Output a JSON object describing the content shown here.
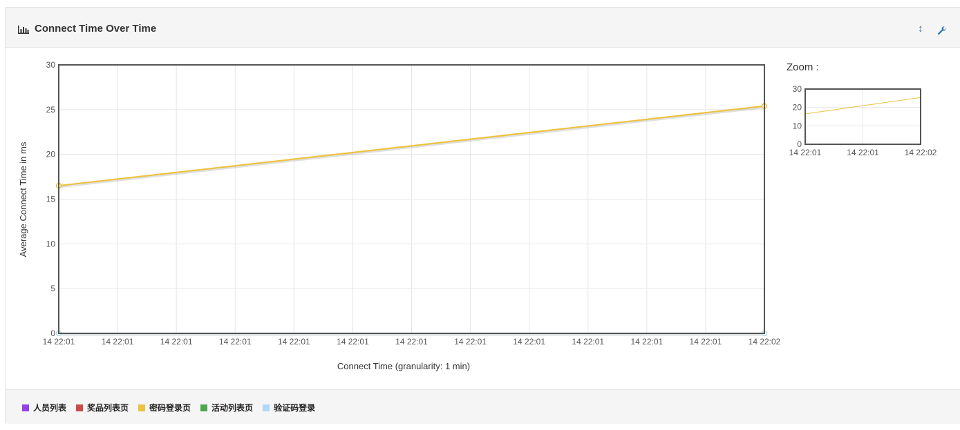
{
  "panel": {
    "title": "Connect Time Over Time"
  },
  "zoom_label": "Zoom :",
  "legend": [
    {
      "label": "人员列表",
      "color": "#9440ed"
    },
    {
      "label": "奖品列表页",
      "color": "#cb4b4b"
    },
    {
      "label": "密码登录页",
      "color": "#edc240"
    },
    {
      "label": "活动列表页",
      "color": "#4da74d"
    },
    {
      "label": "验证码登录",
      "color": "#afd8f8"
    }
  ],
  "chart_data": [
    {
      "type": "line",
      "ylabel": "Average Connect Time in ms",
      "xlabel": "Connect Time (granularity: 1 min)",
      "ylim": [
        0,
        30
      ],
      "yticks": [
        0,
        5,
        10,
        15,
        20,
        25,
        30
      ],
      "xticks": [
        "14 22:01",
        "14 22:01",
        "14 22:01",
        "14 22:01",
        "14 22:01",
        "14 22:01",
        "14 22:01",
        "14 22:01",
        "14 22:01",
        "14 22:01",
        "14 22:01",
        "14 22:01",
        "14 22:02"
      ],
      "grid": true,
      "series": [
        {
          "name": "密码登录页",
          "color": "#edc240",
          "x": [
            0,
            1
          ],
          "y": [
            16.5,
            25.4
          ]
        },
        {
          "name": "验证码登录",
          "color": "#afd8f8",
          "x": [
            0,
            1
          ],
          "y": [
            0,
            0
          ]
        }
      ]
    },
    {
      "type": "line",
      "title": "Zoom :",
      "ylim": [
        0,
        30
      ],
      "yticks": [
        0,
        10,
        20,
        30
      ],
      "xticks": [
        "14 22:01",
        "14 22:01",
        "14 22:02"
      ],
      "grid": true,
      "series": [
        {
          "name": "密码登录页",
          "color": "#edc240",
          "x": [
            0,
            1
          ],
          "y": [
            16.5,
            25.4
          ]
        },
        {
          "name": "验证码登录",
          "color": "#afd8f8",
          "x": [
            0,
            1
          ],
          "y": [
            0,
            0
          ]
        }
      ]
    }
  ]
}
